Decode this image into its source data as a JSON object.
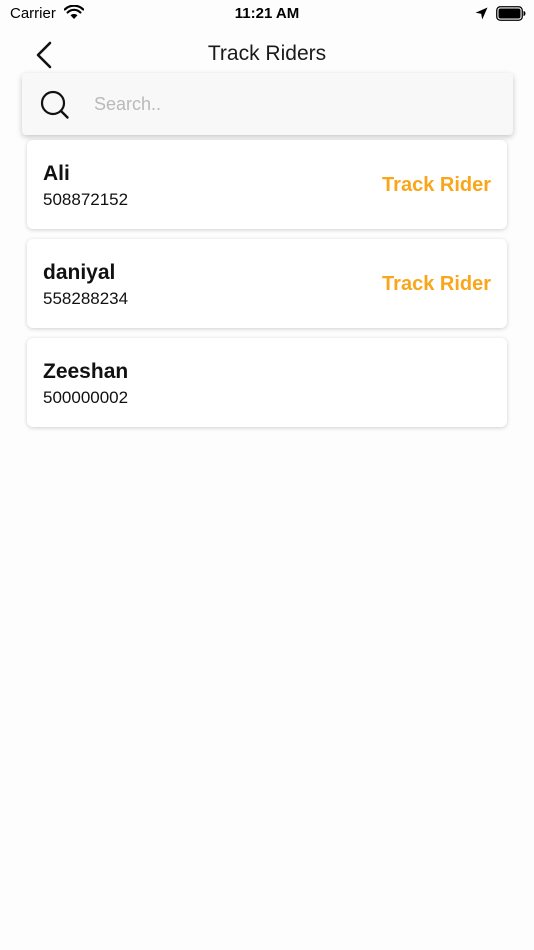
{
  "status_bar": {
    "carrier": "Carrier",
    "time": "11:21 AM"
  },
  "nav": {
    "title": "Track Riders",
    "back_icon": "chevron-left-icon"
  },
  "search": {
    "placeholder": "Search..",
    "value": "",
    "icon": "search-icon"
  },
  "riders": [
    {
      "name": "Ali",
      "phone": "508872152",
      "action": "Track Rider"
    },
    {
      "name": "daniyal",
      "phone": "558288234",
      "action": "Track Rider"
    },
    {
      "name": "Zeeshan",
      "phone": "500000002",
      "action": ""
    }
  ],
  "colors": {
    "accent": "#f9a61a",
    "background": "#fdfdfd",
    "card": "#ffffff"
  }
}
